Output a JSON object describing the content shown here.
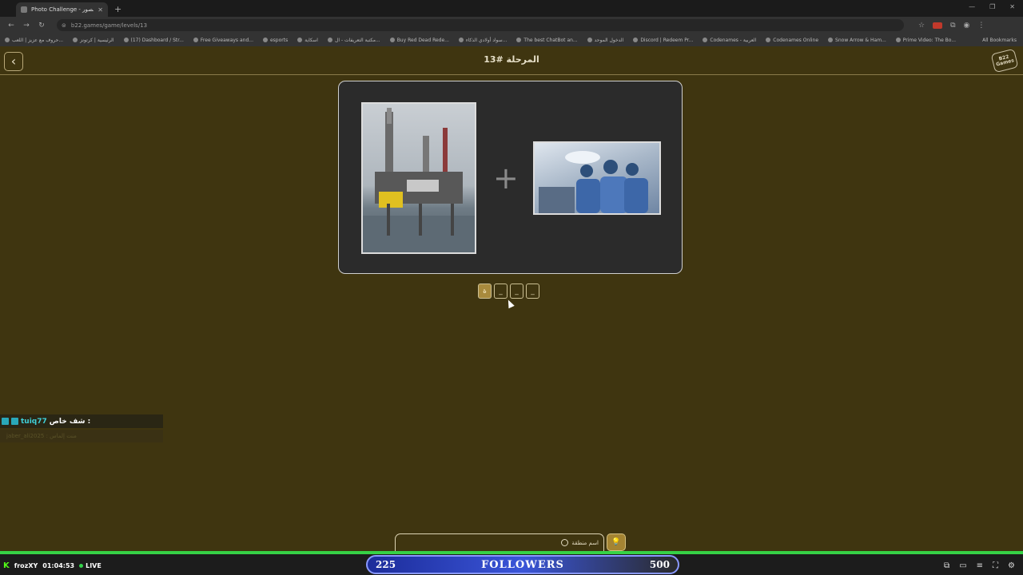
{
  "browser": {
    "tab_title": "Photo Challenge - تحدي الصور",
    "new_tab": "+",
    "url": "b22.games/game/levels/13",
    "bookmarks": [
      "حروف مع عزيز | اللعب...",
      "الرئيسية | كرتونز",
      "(17) Dashboard / Str...",
      "Free Giveaways and...",
      "esports",
      "اسكاية",
      "مكتبة التعريفات - ال...",
      "Buy Red Dead Rede...",
      "سواد أولادي الذكاء...",
      "The best ChatBot an...",
      "الدخول الموحد",
      "Discord | Redeem Pr...",
      "Codenames - العربية",
      "Codenames Online",
      "Snow Arrow & Ham...",
      "Prime Video: The Bo..."
    ],
    "all_bookmarks": "All Bookmarks"
  },
  "game": {
    "level_title": "المرحلة #13",
    "back_icon": "chevron-left-icon",
    "logo_text": "B22 Games",
    "images": [
      {
        "name": "oil-rig-image"
      },
      {
        "name": "surgeons-image"
      }
    ],
    "plus": "+",
    "slots": [
      "ة",
      "_",
      "_",
      "_"
    ],
    "answer_placeholder": "اسم منطقة",
    "hint_icon": "lightbulb-icon"
  },
  "chat": {
    "user": "tuiq77",
    "message": "شف خاص :",
    "faded_message": "jaber_ali2025 : منت إلماس"
  },
  "stream": {
    "timer": "01:04:53",
    "live": "LIVE",
    "streamer": "frozXY",
    "followers_label": "FOLLOWERS",
    "followers_current": "225",
    "followers_goal": "500"
  }
}
